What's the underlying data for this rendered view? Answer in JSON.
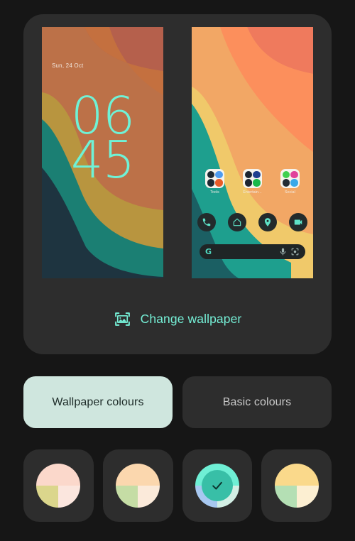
{
  "theme": {
    "page_background": "#161616",
    "card_background": "#2d2d2d",
    "accent_mint": "#75efd6",
    "selected_tab_bg": "#cfe6de",
    "selected_tab_text": "#1d2b28",
    "unselected_tab_text": "#c9c9c9"
  },
  "preview": {
    "lock_screen": {
      "name": "lock-screen-preview",
      "date": "Sun, 24 Oct",
      "clock_hours": "06",
      "clock_minutes": "45",
      "clock_color": "#6ff2d6",
      "wallpaper_colors": [
        "#bc7148",
        "#c4703f",
        "#b5604c",
        "#b8953f",
        "#1b7f73",
        "#1e3440"
      ]
    },
    "home_screen": {
      "name": "home-screen-preview",
      "wallpaper_colors": [
        "#f2a765",
        "#fc8f5c",
        "#ef7a5d",
        "#f0c96a",
        "#1e9f8e",
        "#1b5f63"
      ],
      "folders": [
        {
          "label": "Tools",
          "apps": [
            {
              "name": "app-icon-settings",
              "color": "#1f2a33",
              "dot": "#3ddcb8"
            },
            {
              "name": "app-icon-files",
              "color": "#4f9cf0",
              "dot": "#dff0ff"
            },
            {
              "name": "app-icon-calendar",
              "color": "#1f2a33",
              "dot": "#36c6a5"
            },
            {
              "name": "app-icon-firefox",
              "color": "#e85b28",
              "dot": "#ffb13b"
            }
          ]
        },
        {
          "label": "Entertain...",
          "apps": [
            {
              "name": "app-icon-video",
              "color": "#1c2430",
              "dot": "#4ad3b4"
            },
            {
              "name": "app-icon-music",
              "color": "#1f3f8f",
              "dot": "#7fb2ff"
            },
            {
              "name": "app-icon-photos",
              "color": "#1c2430",
              "dot": "#f05a5a"
            },
            {
              "name": "app-icon-spotify",
              "color": "#18b84a",
              "dot": "#0a7a2c"
            }
          ]
        },
        {
          "label": "Social",
          "apps": [
            {
              "name": "app-icon-whatsapp",
              "color": "#3fd04e",
              "dot": "#ffffff"
            },
            {
              "name": "app-icon-instagram",
              "color": "#e1429b",
              "dot": "#ffd36b"
            },
            {
              "name": "app-icon-mastodon",
              "color": "#232b33",
              "dot": "#e3e3e3"
            },
            {
              "name": "app-icon-telegram",
              "color": "#3aa8e8",
              "dot": "#ffffff"
            }
          ]
        }
      ],
      "dock": [
        {
          "name": "dock-icon-phone",
          "label": "Phone"
        },
        {
          "name": "dock-icon-home",
          "label": "Home"
        },
        {
          "name": "dock-icon-maps",
          "label": "Maps"
        },
        {
          "name": "dock-icon-camera",
          "label": "Camera"
        }
      ],
      "search_bar": {
        "name": "google-search-bar",
        "logo": "G",
        "mic_icon": "microphone-icon",
        "lens_icon": "google-lens-icon",
        "query": ""
      }
    },
    "change_wallpaper": {
      "icon": "image-frame-icon",
      "label": "Change wallpaper"
    }
  },
  "tabs": [
    {
      "id": "wallpaper-colours",
      "label": "Wallpaper colours",
      "selected": true
    },
    {
      "id": "basic-colours",
      "label": "Basic colours",
      "selected": false
    }
  ],
  "colour_swatches": [
    {
      "id": "swatch-1",
      "selected": false,
      "top": "#fbd8cb",
      "bottom_left": "#dbd68c",
      "bottom_right": "#fbe6de"
    },
    {
      "id": "swatch-2",
      "selected": false,
      "top": "#fbd7ae",
      "bottom_left": "#c5dda5",
      "bottom_right": "#fbeada"
    },
    {
      "id": "swatch-3",
      "selected": true,
      "top": "#6fefd5",
      "bottom_left": "#a8c8f0",
      "bottom_right": "#d3efe5",
      "inner": "#38bfa7",
      "check_color": "#0d3730"
    },
    {
      "id": "swatch-4",
      "selected": false,
      "top": "#fad98b",
      "bottom_left": "#b4dfb4",
      "bottom_right": "#fcefd2"
    }
  ]
}
